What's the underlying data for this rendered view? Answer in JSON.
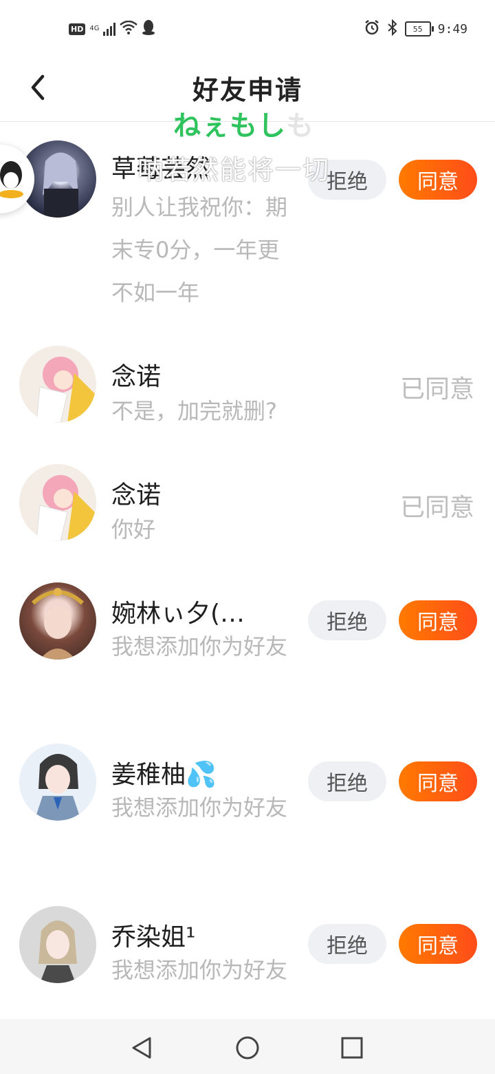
{
  "status_bar": {
    "hd": "HD",
    "network": "4G",
    "battery": "55",
    "time": "9:49"
  },
  "header": {
    "title": "好友申请"
  },
  "overlays": {
    "green_text": "ねぇもし",
    "green_text_tail": "も",
    "white_text": "呐若然能将一切"
  },
  "actions": {
    "reject": "拒绝",
    "accept": "同意",
    "accepted": "已同意"
  },
  "requests": [
    {
      "name": "草莓芸然",
      "message": "别人让我祝你：期末专0分，一年更不如一年",
      "status": "pending"
    },
    {
      "name": "念诺",
      "message": "不是，加完就删?",
      "status": "accepted"
    },
    {
      "name": "念诺",
      "message": "你好",
      "status": "accepted"
    },
    {
      "name": "婉林ぃ夕(…",
      "message": "我想添加你为好友",
      "status": "pending"
    },
    {
      "name": "姜稚柚💦",
      "message": "我想添加你为好友",
      "status": "pending"
    },
    {
      "name": "乔染姐¹",
      "message": "我想添加你为好友",
      "status": "pending"
    }
  ],
  "colors": {
    "accent": "#ff5a12",
    "reject_bg": "#eef0f3",
    "muted": "#b8b8b8"
  }
}
